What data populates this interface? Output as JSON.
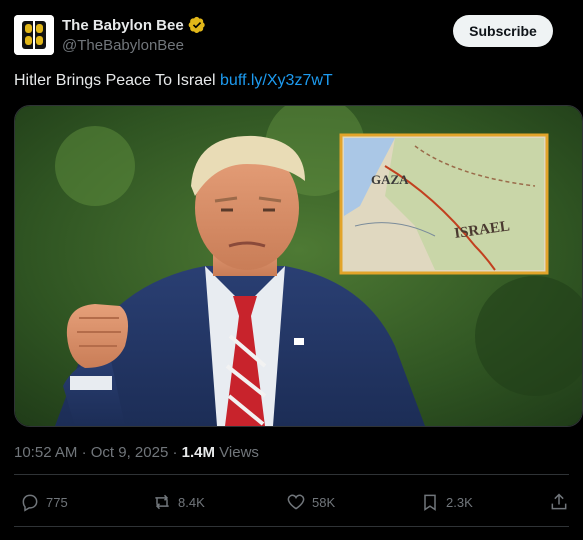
{
  "account": {
    "display_name": "The Babylon Bee",
    "handle": "@TheBabylonBee",
    "verified_color": "#e2b719"
  },
  "subscribe_label": "Subscribe",
  "post": {
    "text": "Hitler Brings Peace To Israel",
    "link": "buff.ly/Xy3z7wT"
  },
  "media": {
    "map_labels": [
      "GAZA",
      "ISRAEL"
    ],
    "description_icon": "photo"
  },
  "meta": {
    "time": "10:52 AM",
    "date": "Oct 9, 2025",
    "views_count": "1.4M",
    "views_label": "Views"
  },
  "actions": {
    "replies": "775",
    "reposts": "8.4K",
    "likes": "58K",
    "bookmarks": "2.3K"
  },
  "colors": {
    "link": "#1d9bf0",
    "muted": "#71767b",
    "text": "#e7e9ea",
    "background": "#000000"
  }
}
